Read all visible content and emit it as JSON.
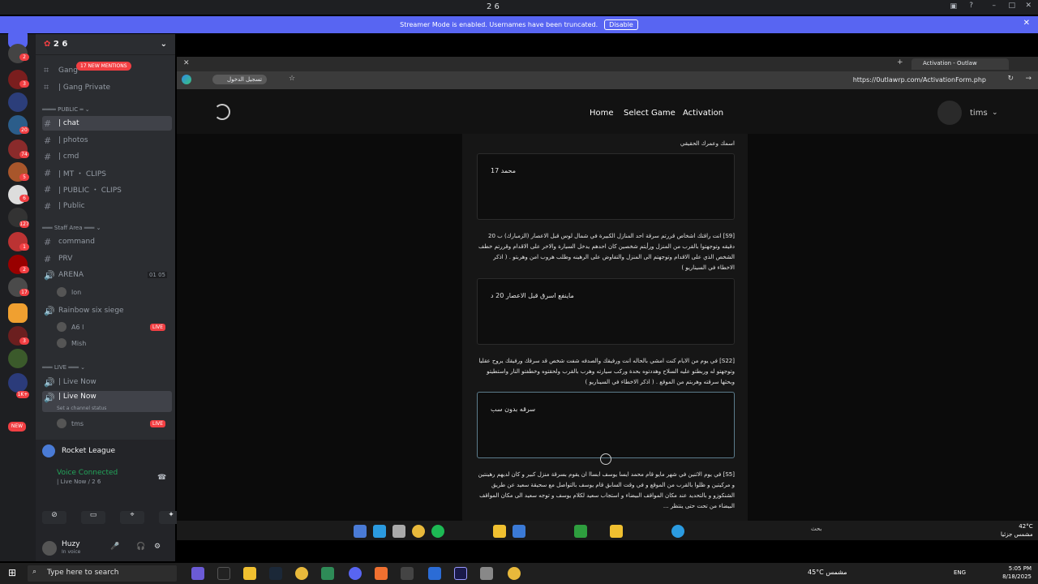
{
  "titlebar": {
    "title": "2 6"
  },
  "banner": {
    "text": "Streamer Mode is enabled. Usernames have been truncated.",
    "button": "Disable"
  },
  "server": {
    "name": "2 6",
    "new_mentions": "17 NEW MENTIONS"
  },
  "server_badges": [
    "2",
    "3",
    "20",
    "74",
    "5",
    "6",
    "127",
    "1",
    "2",
    "17",
    "3",
    "1K+",
    "NEW"
  ],
  "channels": {
    "gang1": "Gang",
    "gang2": "| Gang Private",
    "cat_public": "PUBLIC",
    "chat": "| chat",
    "photos": "| photos",
    "cmd": "| cmd",
    "mt_clips": "| MT ・ CLIPS",
    "public_clips": "| PUBLIC ・ CLIPS",
    "public": "| Public",
    "cat_staff": "Staff Area",
    "command": "command",
    "prv": "PRV",
    "arena": "ARENA",
    "arena_count": "01 05",
    "lon": "lon",
    "rainbow": "Rainbow six siege",
    "a6": "A6 l",
    "mish": "Mish",
    "cat_live": "LIVE",
    "livenow1": "| Live Now",
    "livenow2": "| Live Now",
    "set_status": "Set a channel status",
    "tms": "tms",
    "live": "LIVE"
  },
  "voice": {
    "activity": "Rocket League",
    "status": "Voice Connected",
    "channel": "| Live Now / 2 6"
  },
  "userbar": {
    "name": "Huzy",
    "status": "In voice"
  },
  "browser": {
    "tab_title": "Activation - Outlaw",
    "url": "https://0utlawrp.com/ActivationForm.php",
    "signin": "تسجيل الدخول"
  },
  "site": {
    "nav": [
      "Home",
      "Select Game",
      "Activation"
    ],
    "username": "tims"
  },
  "form": {
    "q1": "اسمك وعمرك الحقيقي",
    "a1": "محمد  17",
    "q2": "[S9] انت راقتك اشخاص قررتم سرقة احد المنازل الكبيرة في شمال لوس قبل الاعصار (الزمبارك) ب 20 دقيقه وتوجهتوا بالقرب من المنزل ورأيتم شخصين كان احدهم يدخل السيارة والاخر على الاقدام وقررتم خطف الشخص الذي على الاقدام وتوجهتم الى المنزل والتفاوض على الرهينه وطلب هروب امن وهربتو . ( اذكر الاخطاء في السيناريو )",
    "a2": "ماينفع اسرق قبل الاعصار 20 د",
    "q3": "[S22] في يوم من الايام كنت امشي بالحاله انت ورفيقك والصدفه شفت شخص قد سرقك ورفيقك يروح عقليا وتوجهتو له وربطتو عليه السلاح وهددتوه بحدة وركب سيارته وهرب بالقرب ولحقتوه وخطفتو النار واستطيتو وبحثها سرقته وهربتم من الموقع . ( اذكر الاخطاء في السيناريو )",
    "a3": "سرقه بدون سب",
    "q4": "[S5] في يوم الاثنين في شهر مايو قام محمد ايسا يوسف ابساا ان يقوم بسرقة منزل كبير و كان لديهم رهينتين و مركيتين و ظلوا بالقرب من الموقع و في وقت السابق قام يوسف بالتواصل مع سحيقة سعيد عن طريق الشنكوزو و بالتحديد عند مكان المواقف البيضاء و استجاب سعيد لكلام يوسف و توجه سعيد الى مكان المواقف البيضاء من تحت حتى ينتظر ..."
  },
  "windows_taskbar": {
    "search": "Type here to search",
    "weather": "45°C",
    "weather_label": "مشمس",
    "time": "5:05 PM",
    "date": "8/18/2025",
    "lang": "ENG"
  },
  "browser_taskbar": {
    "weather": "42°C",
    "weather_label": "مشمس جزئيا",
    "search": "بحث"
  }
}
